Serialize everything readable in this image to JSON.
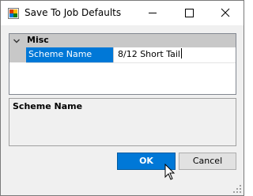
{
  "window": {
    "title": "Save To Job Defaults"
  },
  "property_grid": {
    "category": "Misc",
    "properties": [
      {
        "name": "Scheme Name",
        "value": "8/12 Short Tail"
      }
    ]
  },
  "description": {
    "title": "Scheme Name"
  },
  "buttons": {
    "ok": "OK",
    "cancel": "Cancel"
  },
  "colors": {
    "selection": "#0078d7",
    "category_bg": "#c8c8c8",
    "dialog_bg": "#f0f0f0"
  }
}
